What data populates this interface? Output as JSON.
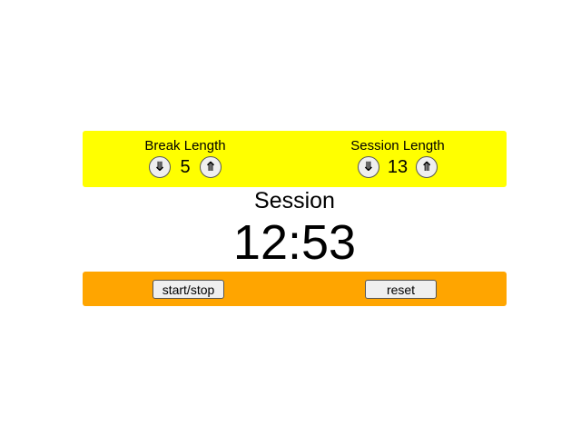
{
  "settings": {
    "break": {
      "label": "Break Length",
      "value": "5",
      "decrement_icon": "⤋",
      "increment_icon": "⤊"
    },
    "session": {
      "label": "Session Length",
      "value": "13",
      "decrement_icon": "⤋",
      "increment_icon": "⤊"
    }
  },
  "timer": {
    "label": "Session",
    "time": "12:53"
  },
  "actions": {
    "start_stop_label": "start/stop",
    "reset_label": "reset"
  },
  "colors": {
    "settings_panel": "#ffff00",
    "actions_panel": "#ffa500"
  }
}
